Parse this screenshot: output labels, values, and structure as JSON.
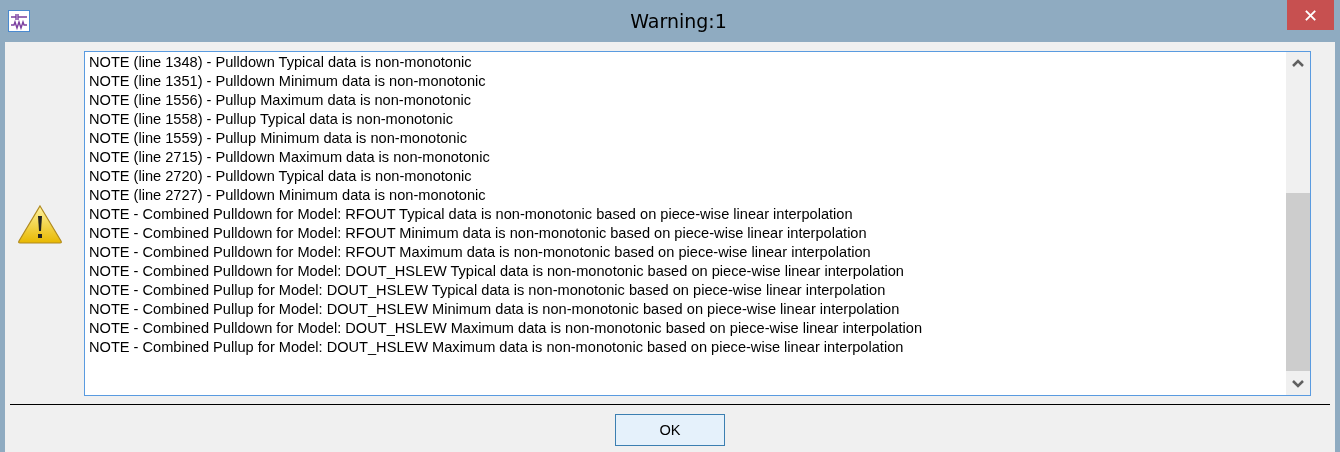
{
  "window": {
    "title": "Warning:1",
    "close_label": "✕"
  },
  "messages": [
    "NOTE (line 1348) - Pulldown Typical data is non-monotonic",
    "NOTE (line 1351) - Pulldown Minimum data is non-monotonic",
    "NOTE (line 1556) - Pullup Maximum data is non-monotonic",
    "NOTE (line 1558) - Pullup Typical data is non-monotonic",
    "NOTE (line 1559) - Pullup Minimum data is non-monotonic",
    "NOTE (line 2715) - Pulldown Maximum data is non-monotonic",
    "NOTE (line 2720) - Pulldown Typical data is non-monotonic",
    "NOTE (line 2727) - Pulldown Minimum data is non-monotonic",
    "NOTE - Combined Pulldown for Model: RFOUT Typical data is non-monotonic based on piece-wise linear interpolation",
    "NOTE - Combined Pulldown for Model: RFOUT Minimum data is non-monotonic based on piece-wise linear interpolation",
    "NOTE - Combined Pulldown for Model: RFOUT Maximum data is non-monotonic based on piece-wise linear interpolation",
    "NOTE - Combined Pulldown for Model: DOUT_HSLEW Typical data is non-monotonic based on piece-wise linear interpolation",
    "NOTE - Combined Pullup for Model: DOUT_HSLEW Typical data is non-monotonic based on piece-wise linear interpolation",
    "NOTE - Combined Pullup for Model: DOUT_HSLEW Minimum data is non-monotonic based on piece-wise linear interpolation",
    "NOTE - Combined Pulldown for Model: DOUT_HSLEW Maximum data is non-monotonic based on piece-wise linear interpolation",
    "NOTE - Combined Pullup for Model: DOUT_HSLEW Maximum data is non-monotonic based on piece-wise linear interpolation"
  ],
  "buttons": [
    "OK"
  ]
}
